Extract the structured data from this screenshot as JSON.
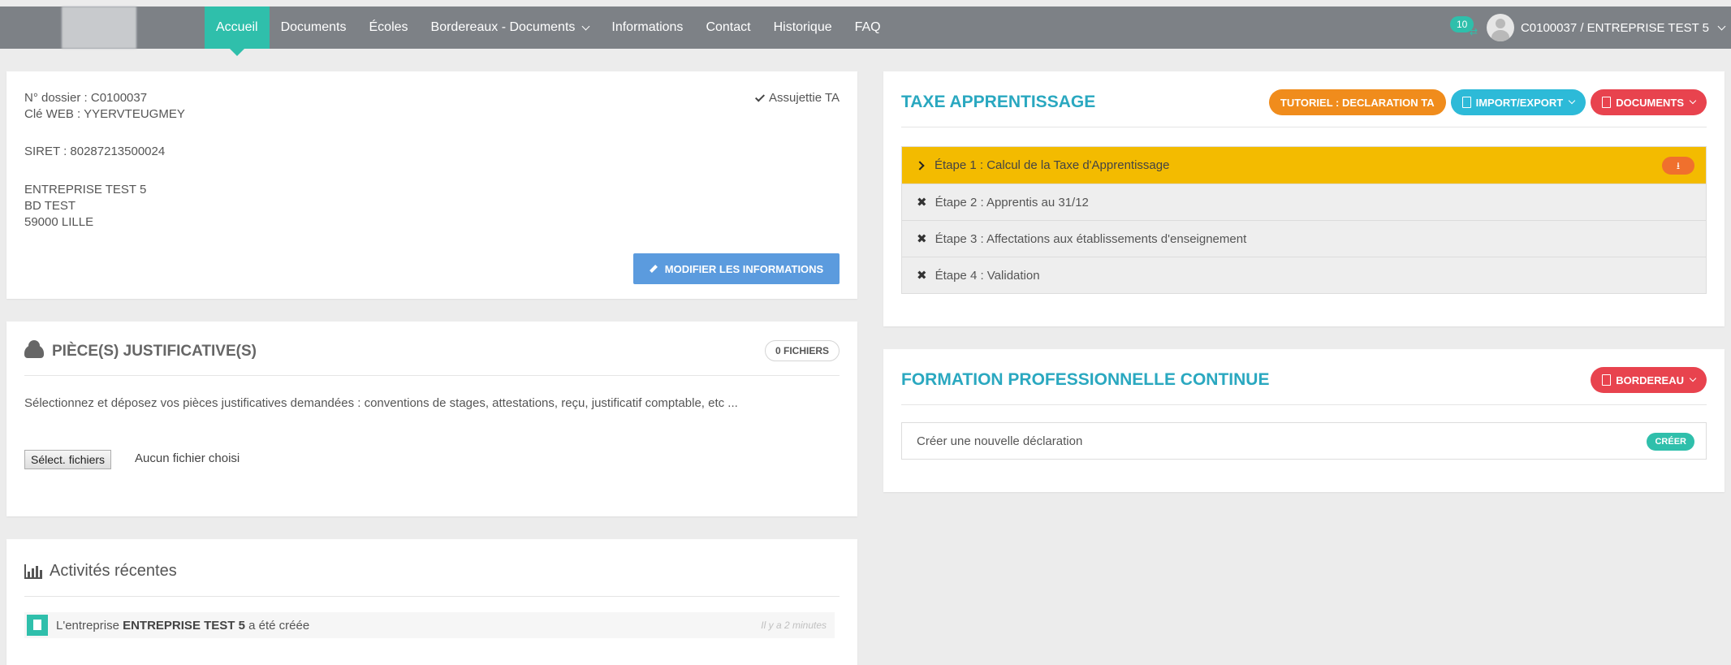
{
  "nav": {
    "items": [
      "Accueil",
      "Documents",
      "Écoles",
      "Bordereaux - Documents",
      "Informations",
      "Contact",
      "Historique",
      "FAQ"
    ],
    "notif_count": "10",
    "user_label": "C0100037 / ENTREPRISE TEST 5"
  },
  "info": {
    "dossier": "N° dossier : C0100037",
    "cle": "Clé WEB : YYERVTEUGMEY",
    "siret": "SIRET : 80287213500024",
    "company": "ENTREPRISE TEST 5",
    "address1": "BD TEST",
    "address2": "59000 LILLE",
    "assujettie": "Assujettie TA",
    "modify_label": "MODIFIER LES INFORMATIONS"
  },
  "pieces": {
    "title": "PIÈCE(S) JUSTIFICATIVE(S)",
    "count_label": "0 FICHIERS",
    "description": "Sélectionnez et déposez vos pièces justificatives demandées : conventions de stages, attestations, reçu, justificatif comptable, etc ...",
    "file_button": "Sélect. fichiers",
    "file_none": "Aucun fichier choisi"
  },
  "activity": {
    "title": "Activités récentes",
    "item_prefix": "L'entreprise",
    "item_company": "ENTREPRISE TEST 5",
    "item_suffix": "a été créée",
    "item_time": "Il y a 2 minutes"
  },
  "taxe": {
    "title": "TAXE APPRENTISSAGE",
    "btn_tutoriel": "TUTORIEL : DECLARATION TA",
    "btn_import": "IMPORT/EXPORT",
    "btn_documents": "DOCUMENTS",
    "steps": [
      "Étape 1 : Calcul de la Taxe d'Apprentissage",
      "Étape 2 : Apprentis au 31/12",
      "Étape 3 : Affectations aux établissements d'enseignement",
      "Étape 4 : Validation"
    ]
  },
  "formation": {
    "title": "FORMATION PROFESSIONNELLE CONTINUE",
    "btn_bordereau": "BORDEREAU",
    "row_label": "Créer une nouvelle déclaration",
    "creer_label": "CRÉER"
  },
  "colors": {
    "accent": "#2fbfab",
    "nav_bg": "#7d8186",
    "title_teal": "#2aa8c0",
    "orange": "#f08c1c",
    "cyan": "#2dbad8",
    "red": "#e8434e",
    "step_active": "#f3bb00",
    "modify_blue": "#5b9bde"
  }
}
